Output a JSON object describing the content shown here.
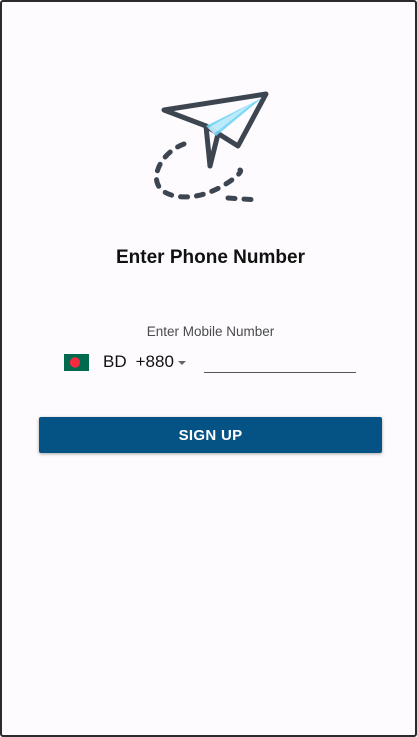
{
  "screen": {
    "title": "Enter Phone Number",
    "logo_icon": "paper-plane-icon"
  },
  "phone_form": {
    "label": "Enter Mobile Number",
    "country": {
      "flag_icon": "bangladesh-flag-icon",
      "code": "BD",
      "dial_code": "+880"
    },
    "phone_value": "",
    "phone_placeholder": ""
  },
  "actions": {
    "signup_label": "SIGN UP"
  },
  "colors": {
    "primary_button": "#055384",
    "flag_green": "#006a4e",
    "flag_red": "#f42a41",
    "plane_accent": "#6fd3f5",
    "plane_outline": "#3d4650"
  }
}
